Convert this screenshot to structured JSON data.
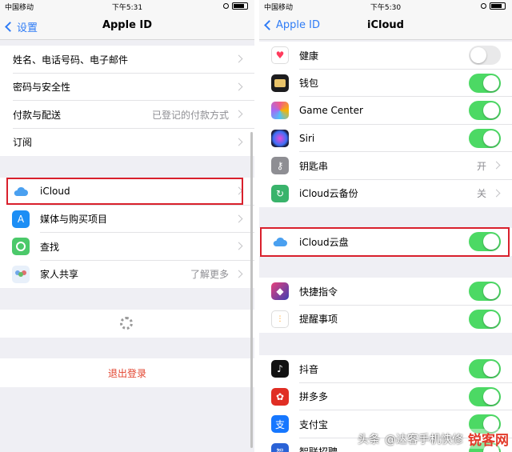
{
  "left": {
    "status": {
      "carrier": "中国移动",
      "time": "下午5:31"
    },
    "nav": {
      "back": "设置",
      "title": "Apple ID"
    },
    "group1": [
      {
        "label": "姓名、电话号码、电子邮件",
        "value": ""
      },
      {
        "label": "密码与安全性",
        "value": ""
      },
      {
        "label": "付款与配送",
        "value": "已登记的付款方式"
      },
      {
        "label": "订阅",
        "value": ""
      }
    ],
    "group2": [
      {
        "label": "iCloud",
        "value": "",
        "icon": "icloud-icon"
      },
      {
        "label": "媒体与购买项目",
        "value": "",
        "icon": "app-store-icon"
      },
      {
        "label": "查找",
        "value": "",
        "icon": "find-my-icon"
      },
      {
        "label": "家人共享",
        "value": "了解更多",
        "icon": "family-sharing-icon"
      }
    ],
    "logout": "退出登录"
  },
  "right": {
    "status": {
      "carrier": "中国移动",
      "time": "下午5:30"
    },
    "nav": {
      "back": "Apple ID",
      "title": "iCloud"
    },
    "group1": [
      {
        "label": "健康",
        "toggle": false,
        "icon": "health-icon",
        "color": "#ffffff"
      },
      {
        "label": "钱包",
        "toggle": true,
        "icon": "wallet-icon",
        "color": "#1c1c1e"
      },
      {
        "label": "Game Center",
        "toggle": true,
        "icon": "game-center-icon",
        "color": "#f25c8a"
      },
      {
        "label": "Siri",
        "toggle": true,
        "icon": "siri-icon",
        "color": "#1b1b3a"
      },
      {
        "label": "钥匙串",
        "value": "开",
        "icon": "keychain-icon",
        "color": "#8e8e93"
      },
      {
        "label": "iCloud云备份",
        "value": "关",
        "icon": "icloud-backup-icon",
        "color": "#39b36b"
      }
    ],
    "group2": [
      {
        "label": "iCloud云盘",
        "toggle": true,
        "icon": "icloud-drive-icon",
        "color": "#ffffff"
      }
    ],
    "group3": [
      {
        "label": "快捷指令",
        "toggle": true,
        "icon": "shortcuts-icon",
        "color": "#3d3fb3"
      },
      {
        "label": "提醒事项",
        "toggle": true,
        "icon": "reminders-icon",
        "color": "#ffffff"
      }
    ],
    "group4": [
      {
        "label": "抖音",
        "toggle": true,
        "icon": "douyin-icon",
        "color": "#111111"
      },
      {
        "label": "拼多多",
        "toggle": true,
        "icon": "pinduoduo-icon",
        "color": "#e02e24"
      },
      {
        "label": "支付宝",
        "toggle": true,
        "icon": "alipay-icon",
        "color": "#1677ff"
      },
      {
        "label": "智联招聘",
        "toggle": true,
        "icon": "zhilian-icon",
        "color": "#2a62d6"
      }
    ]
  },
  "watermark": {
    "prefix": "头条",
    "handle": "@达客手机快修",
    "brand": "锐客网"
  }
}
